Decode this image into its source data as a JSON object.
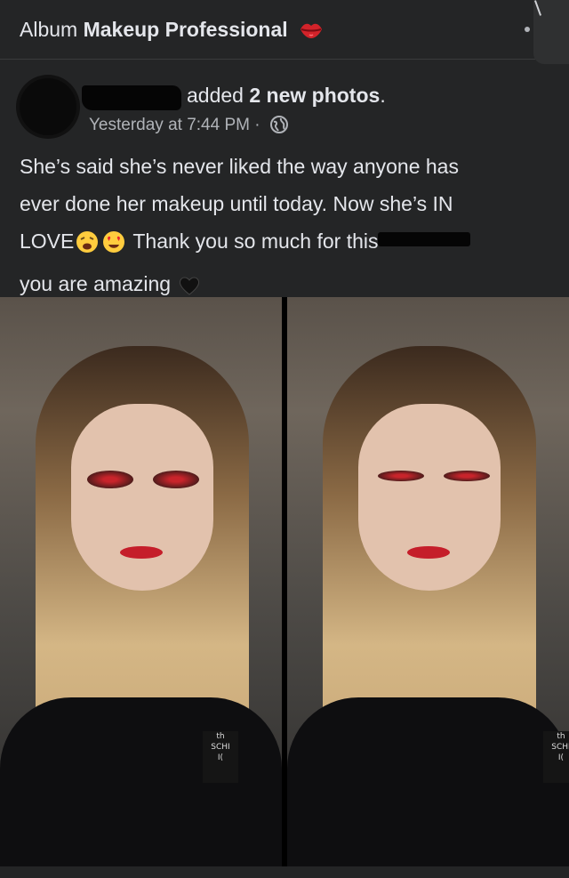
{
  "header": {
    "album_prefix": "Album",
    "album_name": "Makeup Professional",
    "icons": [
      "lips-icon",
      "more-icon"
    ]
  },
  "post": {
    "action_text": "added",
    "action_bold": "2 new photos",
    "action_suffix": ".",
    "timestamp": "Yesterday at 7:44 PM",
    "separator": "·",
    "privacy_icon": "globe-icon",
    "caption": {
      "line1": "She’s said she’s never liked the way anyone has",
      "line2": "ever done her makeup until today. Now she’s IN",
      "line3a": "LOVE",
      "line3b": "Thank you so much for this",
      "line4": "you are amazing",
      "emojis": [
        "weary-face-icon",
        "heart-eyes-icon",
        "black-heart-icon"
      ]
    }
  },
  "photos": {
    "count": 2,
    "items": [
      "photo-1",
      "photo-2"
    ],
    "shirt_text_1": "th",
    "shirt_text_2": "SCHI",
    "shirt_text_3": "I("
  },
  "colors": {
    "background": "#242526",
    "text": "#e4e6eb",
    "secondary_text": "#b0b3b8",
    "lips": "#d2232a"
  }
}
